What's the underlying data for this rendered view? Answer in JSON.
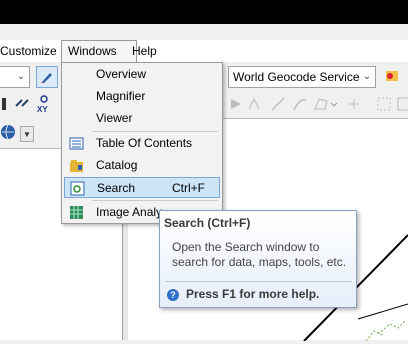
{
  "menubar": {
    "customize": "Customize",
    "windows": "Windows",
    "help": "Help"
  },
  "toolbar": {
    "geocode_service": "World Geocode Service (A"
  },
  "windows_menu": {
    "items": [
      {
        "label": "Overview",
        "icon": "none"
      },
      {
        "label": "Magnifier",
        "icon": "none"
      },
      {
        "label": "Viewer",
        "icon": "none"
      },
      {
        "label": "Table Of Contents",
        "icon": "table-of-contents-icon"
      },
      {
        "label": "Catalog",
        "icon": "catalog-icon"
      },
      {
        "label": "Search",
        "shortcut": "Ctrl+F",
        "icon": "search-window-icon",
        "selected": true
      },
      {
        "label": "Image Analy",
        "icon": "image-analysis-icon"
      }
    ]
  },
  "tooltip": {
    "title": "Search (Ctrl+F)",
    "body": "Open the Search window to search for data, maps, tools, etc.",
    "help": "Press F1 for more help."
  },
  "colors": {
    "selection": "#cce4f7",
    "tooltip_border": "#8aa0c0",
    "help_icon": "#2f6fc8"
  }
}
